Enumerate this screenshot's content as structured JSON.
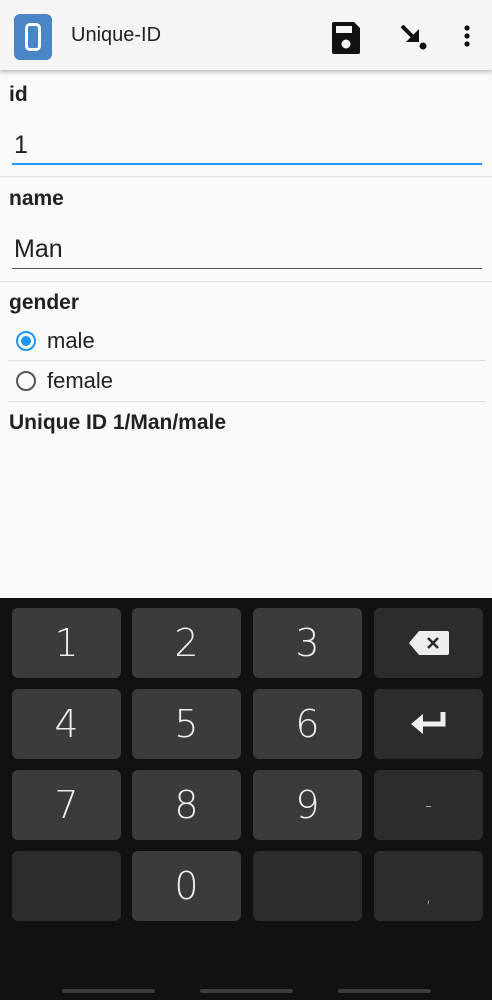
{
  "app": {
    "title": "Unique-ID",
    "icons": [
      "app-logo-icon",
      "save-icon",
      "import-arrow-icon",
      "more-vert-icon"
    ]
  },
  "form": {
    "id_label": "id",
    "id_value": "1",
    "name_label": "name",
    "name_value": "Man",
    "gender_label": "gender",
    "gender_options": [
      {
        "label": "male",
        "selected": true
      },
      {
        "label": "female",
        "selected": false
      }
    ],
    "result_text": "Unique ID 1/Man/male"
  },
  "keyboard": {
    "keys": [
      "1",
      "2",
      "3",
      "4",
      "5",
      "6",
      "7",
      "8",
      "9",
      "0",
      "-",
      ","
    ],
    "icons": [
      "backspace-icon",
      "enter-icon"
    ]
  },
  "colors": {
    "accent": "#2196f3",
    "app_icon": "#4a86c5",
    "keyboard_bg": "#111111",
    "key_bg": "#3b3b3b"
  }
}
